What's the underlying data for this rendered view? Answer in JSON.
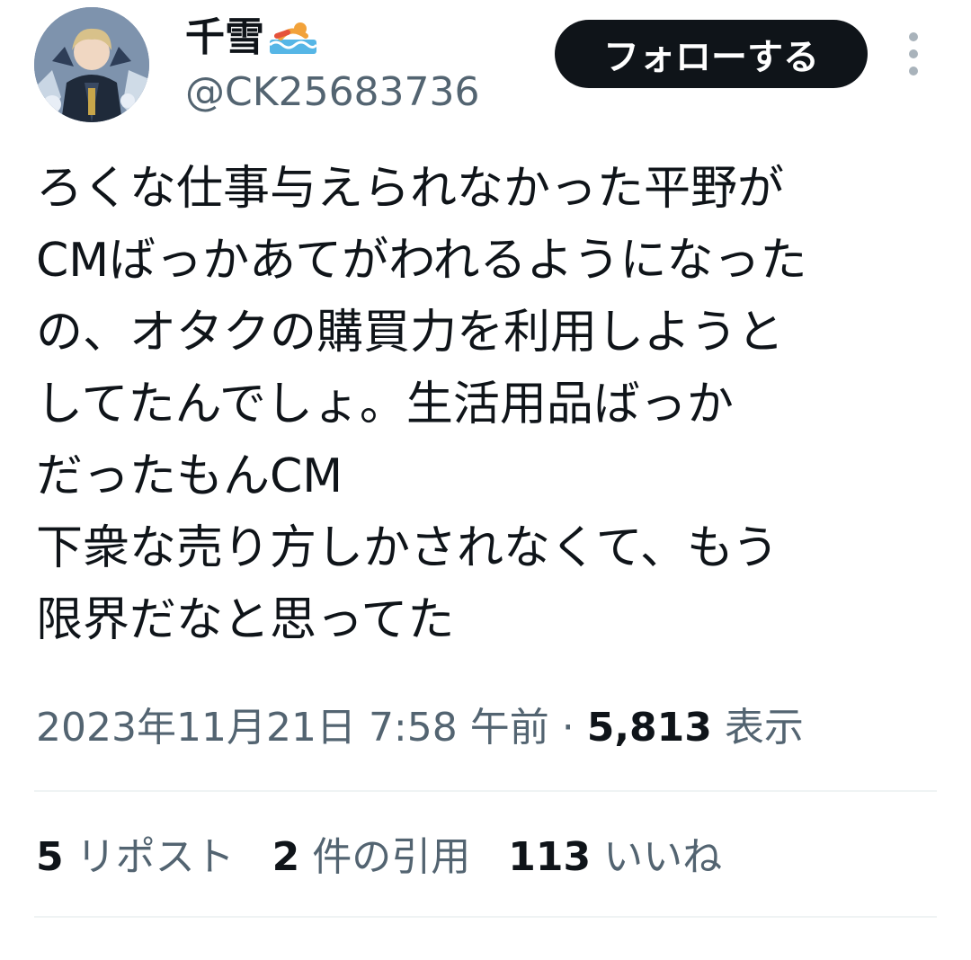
{
  "user": {
    "display_name": "千雪",
    "name_emoji": "swimmer-emoji",
    "handle": "@CK25683736"
  },
  "header": {
    "follow_label": "フォローする",
    "more_icon": "more-vertical-icon"
  },
  "tweet": {
    "text": "ろくな仕事与えられなかった平野が\nCMばっかあてがわれるようになった\nの、オタクの購買力を利用しようと\nしてたんでしょ。生活用品ばっか\nだったもんCM\n下衆な売り方しかされなくて、もう\n限界だなと思ってた"
  },
  "meta": {
    "timestamp": "2023年11月21日 7:58 午前",
    "separator": " · ",
    "views_count": "5,813",
    "views_label": "表示"
  },
  "stats": {
    "reposts_count": "5",
    "reposts_label": "リポスト",
    "quotes_count": "2",
    "quotes_label": "件の引用",
    "likes_count": "113",
    "likes_label": "いいね"
  },
  "colors": {
    "text_primary": "#0f1419",
    "text_secondary": "#536471",
    "divider": "#eff3f4",
    "follow_bg": "#0f1419"
  }
}
